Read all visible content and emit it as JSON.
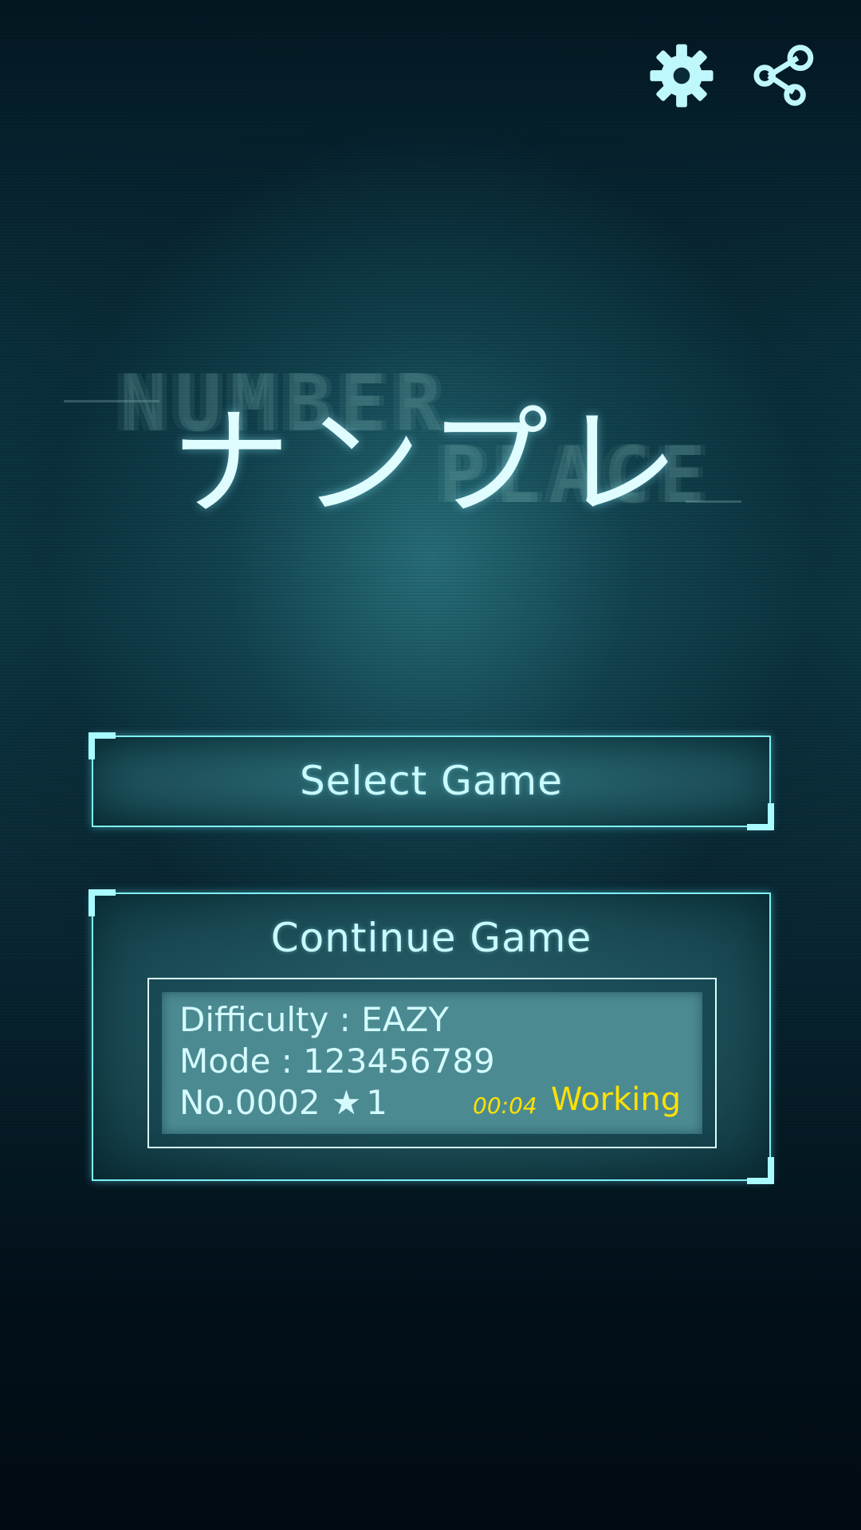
{
  "header": {
    "settings_icon": "gear-icon",
    "share_icon": "share-icon"
  },
  "logo": {
    "title": "ナンプレ",
    "bg_line1": "NUMBER",
    "bg_line2": "PLACE"
  },
  "menu": {
    "select_label": "Select Game",
    "continue_label": "Continue Game"
  },
  "saved_game": {
    "difficulty": "Difficulty : EAZY",
    "mode": "Mode : 123456789",
    "number": "No.0002",
    "star_icon": "★",
    "stars": "1",
    "time": "00:04",
    "status": "Working"
  },
  "colors": {
    "accent": "#7ef1f6",
    "highlight": "#ffe100",
    "text": "#c8fbff"
  }
}
